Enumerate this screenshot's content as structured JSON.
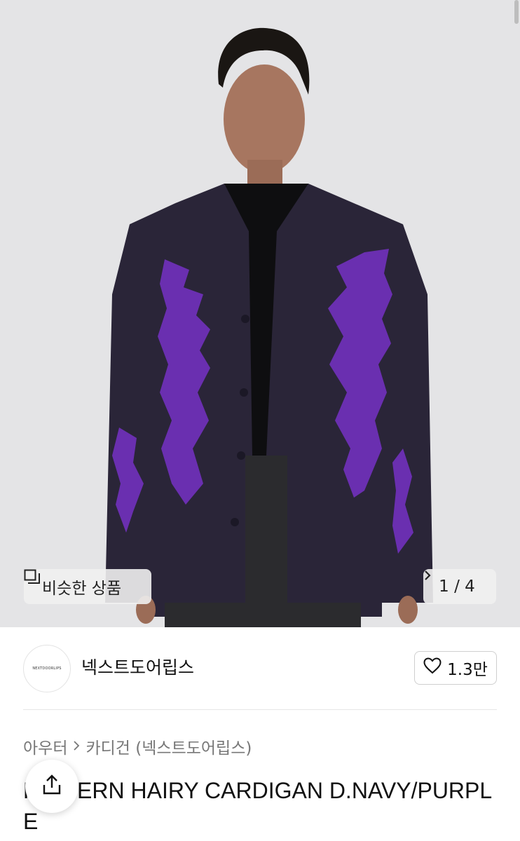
{
  "hero": {
    "similar_label": "비슷한 상품",
    "pager": "1 / 4",
    "image_alt": "Model wearing dark navy cardigan with purple flame pattern"
  },
  "seller": {
    "logo_text": "NEXTDOORLIPS",
    "name": "넥스트도어립스",
    "like_count": "1.3만"
  },
  "product": {
    "breadcrumb_parent": "아우터",
    "breadcrumb_child": "카디건 (넥스트도어립스)",
    "title": "PATTERN HAIRY CARDIGAN D.NAVY/PURPLE"
  },
  "colors": {
    "cardigan": "#2a2538",
    "pattern": "#6a2fb0",
    "tee": "#0e0e10",
    "background": "#e4e4e6"
  }
}
